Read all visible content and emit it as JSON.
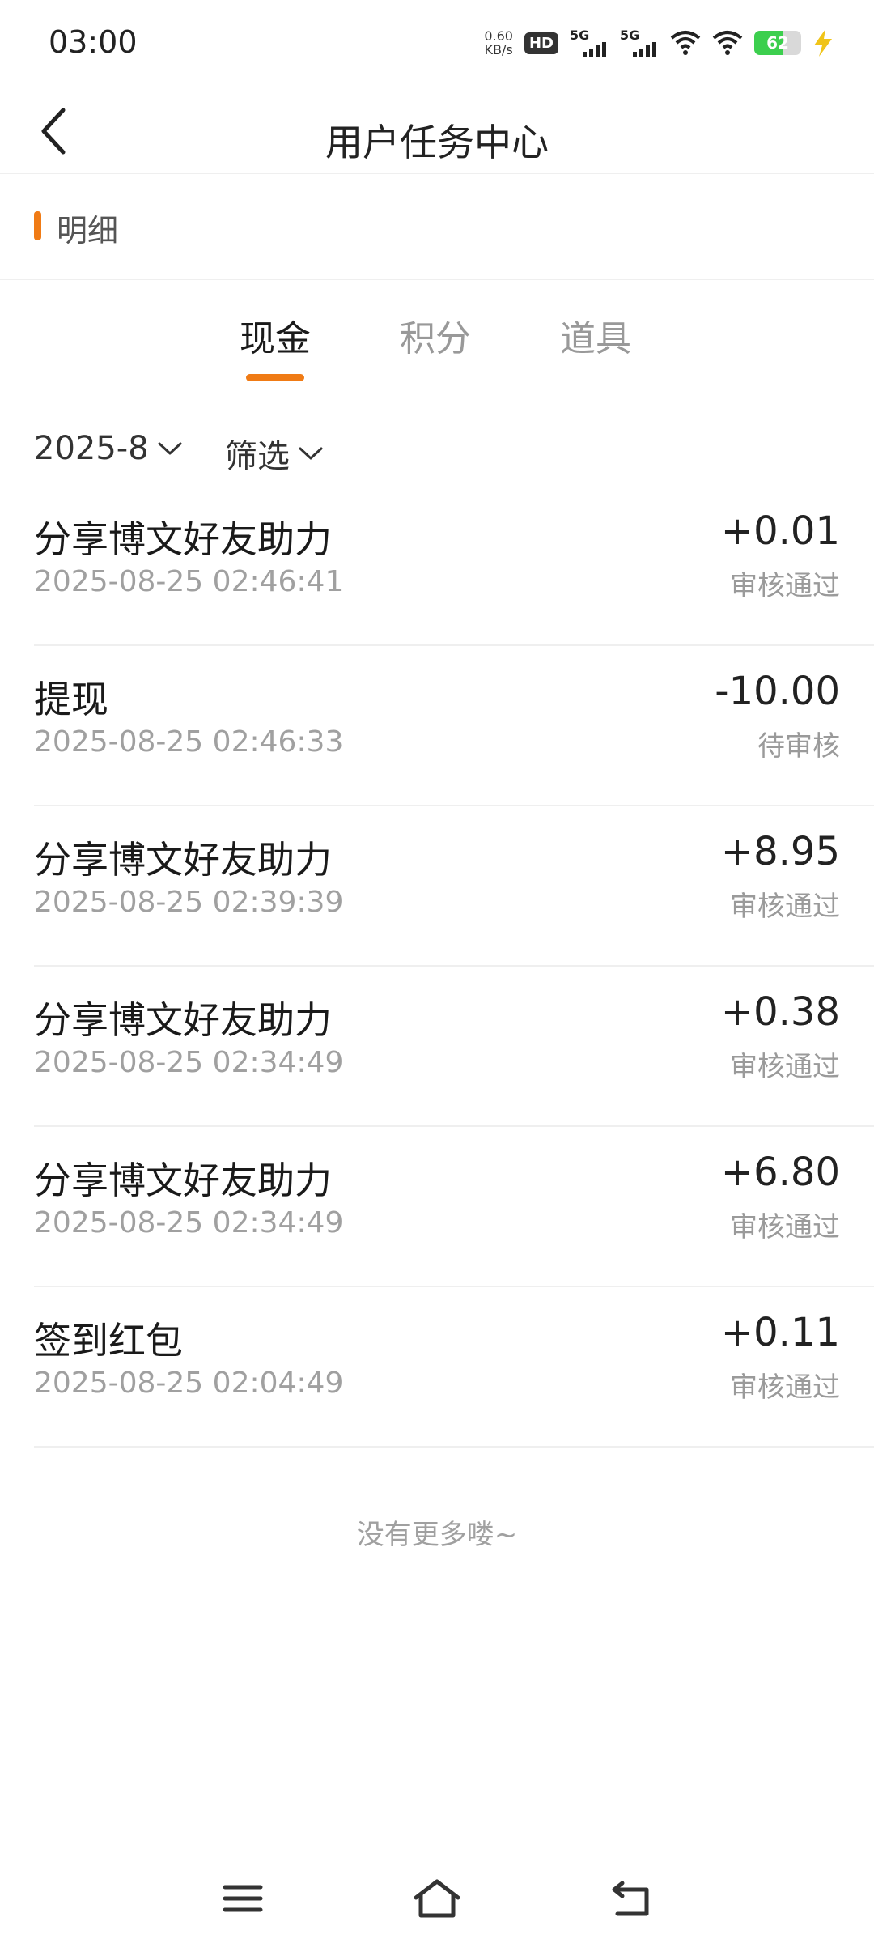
{
  "status_bar": {
    "time": "03:00",
    "net_speed_value": "0.60",
    "net_speed_unit": "KB/s",
    "hd_label": "HD",
    "signal1_label": "5G",
    "signal2_label": "5G",
    "battery_level": "62",
    "icons": [
      "hd-icon",
      "signal-5g-icon",
      "signal-5g-icon",
      "wifi-plus-icon",
      "wifi-icon",
      "battery-icon",
      "charging-bolt-icon"
    ]
  },
  "header": {
    "title": "用户任务中心",
    "back_icon": "chevron-left-icon"
  },
  "section": {
    "title": "明细",
    "accent_color": "#f07b15"
  },
  "tabs": [
    {
      "label": "现金",
      "active": true
    },
    {
      "label": "积分",
      "active": false
    },
    {
      "label": "道具",
      "active": false
    }
  ],
  "filters": {
    "month": "2025-8",
    "filter_label": "筛选"
  },
  "transactions": [
    {
      "title": "分享博文好友助力",
      "time": "2025-08-25 02:46:41",
      "amount": "+0.01",
      "status": "审核通过"
    },
    {
      "title": "提现",
      "time": "2025-08-25 02:46:33",
      "amount": "-10.00",
      "status": "待审核"
    },
    {
      "title": "分享博文好友助力",
      "time": "2025-08-25 02:39:39",
      "amount": "+8.95",
      "status": "审核通过"
    },
    {
      "title": "分享博文好友助力",
      "time": "2025-08-25 02:34:49",
      "amount": "+0.38",
      "status": "审核通过"
    },
    {
      "title": "分享博文好友助力",
      "time": "2025-08-25 02:34:49",
      "amount": "+6.80",
      "status": "审核通过"
    },
    {
      "title": "签到红包",
      "time": "2025-08-25 02:04:49",
      "amount": "+0.11",
      "status": "审核通过"
    }
  ],
  "footer_text": "没有更多喽~",
  "nav_bar": {
    "icons": [
      "menu-icon",
      "home-icon",
      "back-icon"
    ]
  }
}
